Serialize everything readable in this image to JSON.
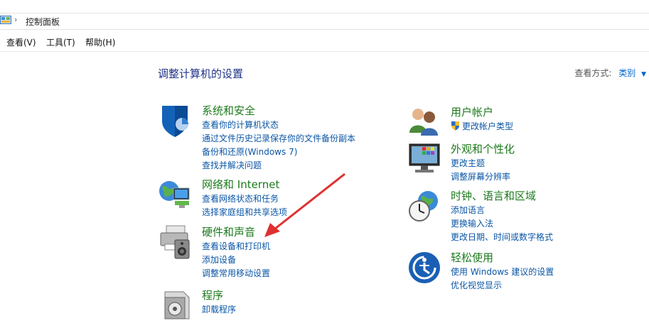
{
  "address": {
    "path": "控制面板",
    "separator": "›"
  },
  "menu": [
    {
      "label": "查看(V)"
    },
    {
      "label": "工具(T)"
    },
    {
      "label": "帮助(H)"
    }
  ],
  "page": {
    "title": "调整计算机的设置"
  },
  "view_by": {
    "label": "查看方式:",
    "value": "类别"
  },
  "categories_left": [
    {
      "icon": "security-shield-icon",
      "title": "系统和安全",
      "links": [
        "查看你的计算机状态",
        "通过文件历史记录保存你的文件备份副本",
        "备份和还原(Windows 7)",
        "查找并解决问题"
      ]
    },
    {
      "icon": "network-globe-icon",
      "title": "网络和 Internet",
      "links": [
        "查看网络状态和任务",
        "选择家庭组和共享选项"
      ]
    },
    {
      "icon": "printer-speaker-icon",
      "title": "硬件和声音",
      "links": [
        "查看设备和打印机",
        "添加设备",
        "调整常用移动设置"
      ]
    },
    {
      "icon": "programs-box-icon",
      "title": "程序",
      "links": [
        "卸载程序"
      ]
    }
  ],
  "categories_right": [
    {
      "icon": "users-icon",
      "title": "用户帐户",
      "links": [
        "更改帐户类型"
      ]
    },
    {
      "icon": "display-color-icon",
      "title": "外观和个性化",
      "links": [
        "更改主题",
        "调整屏幕分辨率"
      ]
    },
    {
      "icon": "clock-globe-icon",
      "title": "时钟、语言和区域",
      "links": [
        "添加语言",
        "更换输入法",
        "更改日期、时间或数字格式"
      ]
    },
    {
      "icon": "ease-of-access-icon",
      "title": "轻松使用",
      "links": [
        "使用 Windows 建议的设置",
        "优化视觉显示"
      ]
    }
  ],
  "colors": {
    "heading": "#1c7a1c",
    "link": "#0a56a6",
    "title": "#1e3287",
    "annotation": "#e03030"
  }
}
